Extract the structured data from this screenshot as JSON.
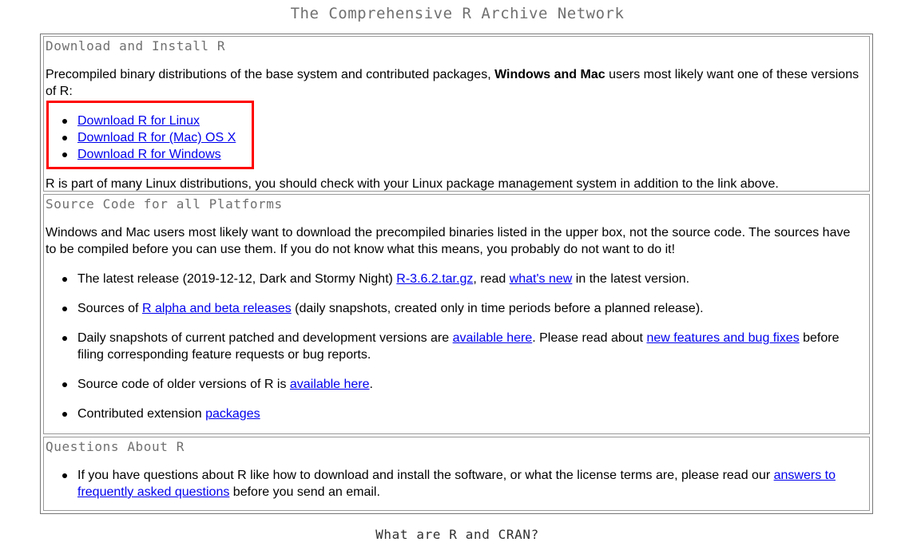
{
  "page": {
    "title": "The Comprehensive R Archive Network",
    "footer_heading": "What are R and CRAN?"
  },
  "download": {
    "heading": "Download and Install R",
    "intro_before": "Precompiled binary distributions of the base system and contributed packages, ",
    "intro_bold": "Windows and Mac",
    "intro_after": " users most likely want one of these versions of R:",
    "links": [
      "Download R for Linux",
      "Download R for (Mac) OS X",
      "Download R for Windows"
    ],
    "note": "R is part of many Linux distributions, you should check with your Linux package management system in addition to the link above."
  },
  "source": {
    "heading": "Source Code for all Platforms",
    "intro": "Windows and Mac users most likely want to download the precompiled binaries listed in the upper box, not the source code. The sources have to be compiled before you can use them. If you do not know what this means, you probably do not want to do it!",
    "item1": {
      "before": "The latest release (2019-12-12, Dark and Stormy Night) ",
      "link1": "R-3.6.2.tar.gz",
      "middle": ", read ",
      "link2": "what's new",
      "after": " in the latest version."
    },
    "item2": {
      "before": "Sources of ",
      "link": "R alpha and beta releases",
      "after": " (daily snapshots, created only in time periods before a planned release)."
    },
    "item3": {
      "before": "Daily snapshots of current patched and development versions are ",
      "link1": "available here",
      "middle": ". Please read about ",
      "link2": "new features and bug fixes",
      "after": " before filing corresponding feature requests or bug reports."
    },
    "item4": {
      "before": "Source code of older versions of R is ",
      "link": "available here",
      "after": "."
    },
    "item5": {
      "before": "Contributed extension ",
      "link": "packages"
    }
  },
  "questions": {
    "heading": "Questions About R",
    "before": "If you have questions about R like how to download and install the software, or what the license terms are, please read our ",
    "link": "answers to frequently asked questions",
    "after": " before you send an email."
  },
  "colors": {
    "link": "#0000ee",
    "highlight": "#ff0000",
    "heading_gray": "#707070"
  }
}
